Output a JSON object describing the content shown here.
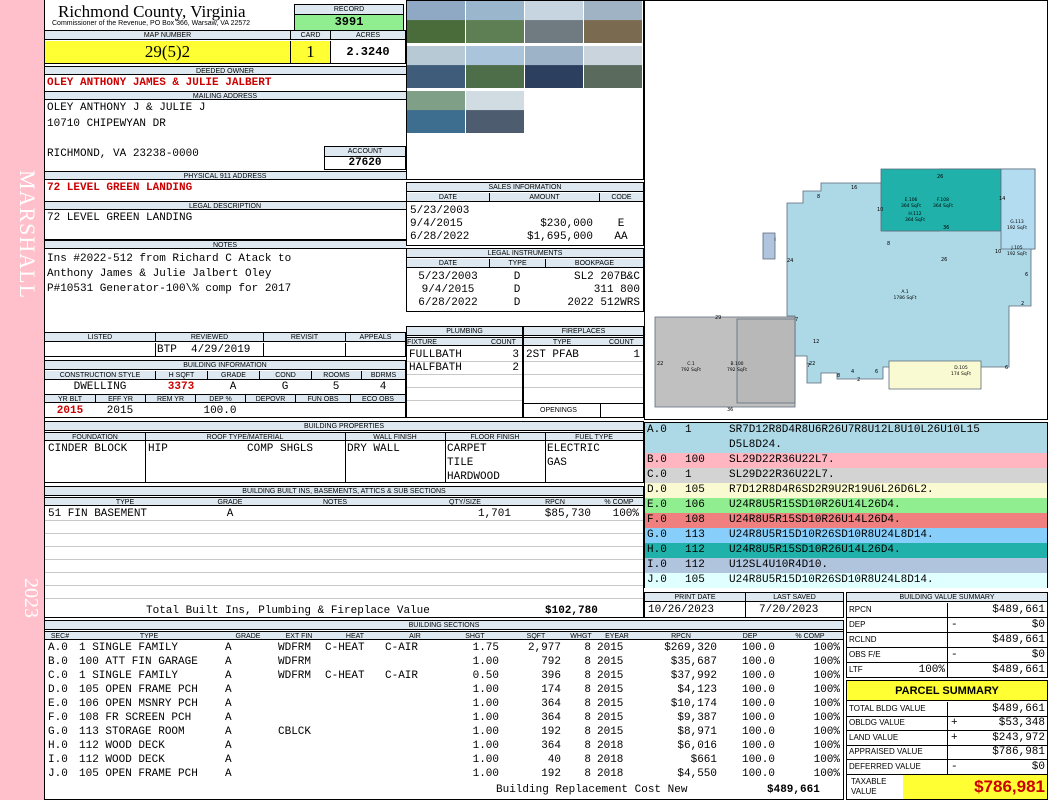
{
  "sidebar": {
    "district": "MARSHALL",
    "year": "2023"
  },
  "header": {
    "county": "Richmond County, Virginia",
    "commissioner": "Commissioner of the Revenue, PO Box 366, Warsaw, VA 22572",
    "record_label": "RECORD",
    "record": "3991",
    "map_label": "MAP NUMBER",
    "map": "29(5)2",
    "card_label": "CARD",
    "card": "1",
    "acres_label": "ACRES",
    "acres": "2.3240"
  },
  "owner": {
    "deeded_label": "DEEDED OWNER",
    "deeded": "OLEY ANTHONY JAMES & JULIE JALBERT",
    "mailing_label": "MAILING ADDRESS",
    "mailing": [
      "OLEY ANTHONY J & JULIE J",
      "10710 CHIPEWYAN DR",
      "",
      "RICHMOND, VA 23238-0000"
    ],
    "account_label": "ACCOUNT",
    "account": "27620",
    "physical_label": "PHYSICAL 911 ADDRESS",
    "physical": "72 LEVEL GREEN LANDING",
    "legal_label": "LEGAL DESCRIPTION",
    "legal": "72 LEVEL GREEN LANDING",
    "notes_label": "NOTES",
    "notes": [
      "Ins #2022-512 from Richard C Atack to",
      "Anthony James & Julie Jalbert Oley",
      "P#10531 Generator-100\\% comp for 2017"
    ]
  },
  "sales": {
    "title": "SALES INFORMATION",
    "headers": [
      "DATE",
      "AMOUNT",
      "CODE"
    ],
    "rows": [
      [
        "5/23/2003",
        "",
        ""
      ],
      [
        "9/4/2015",
        "$230,000",
        "E"
      ],
      [
        "6/28/2022",
        "$1,695,000",
        "AA"
      ]
    ]
  },
  "instruments": {
    "title": "LEGAL INSTRUMENTS",
    "headers": [
      "DATE",
      "TYPE",
      "BOOKPAGE"
    ],
    "rows": [
      [
        "5/23/2003",
        "D",
        "SL2 207B&C"
      ],
      [
        "9/4/2015",
        "D",
        "311 800"
      ],
      [
        "6/28/2022",
        "D",
        "2022 512WRS"
      ]
    ]
  },
  "review": {
    "headers": [
      "LISTED",
      "REVIEWED",
      "REVISIT",
      "APPEALS"
    ],
    "reviewed_by": "BTP",
    "reviewed_date": "4/29/2019"
  },
  "building_info": {
    "title": "BUILDING INFORMATION",
    "headers": [
      "CONSTRUCTION STYLE",
      "H SQFT",
      "GRADE",
      "COND",
      "ROOMS",
      "BDRMS"
    ],
    "values": [
      "DWELLING",
      "3373",
      "A",
      "G",
      "5",
      "4"
    ],
    "headers2": [
      "YR BLT",
      "EFF YR",
      "REM YR",
      "DEP %",
      "DEPOVR",
      "FUN OBS",
      "ECO OBS"
    ],
    "values2": [
      "2015",
      "2015",
      "",
      "100.0",
      "",
      "",
      ""
    ]
  },
  "plumbing": {
    "title": "PLUMBING",
    "headers": [
      "FIXTURE",
      "COUNT"
    ],
    "rows": [
      [
        "FULLBATH",
        "3"
      ],
      [
        "HALFBATH",
        "2"
      ]
    ]
  },
  "fireplaces": {
    "title": "FIREPLACES",
    "headers": [
      "TYPE",
      "COUNT"
    ],
    "rows": [
      [
        "2ST PFAB",
        "1"
      ]
    ],
    "openings": "OPENINGS"
  },
  "properties": {
    "title": "BUILDING PROPERTIES",
    "headers": [
      "FOUNDATION",
      "ROOF TYPE/MATERIAL",
      "WALL FINISH",
      "FLOOR FINISH",
      "FUEL TYPE"
    ],
    "foundation": "CINDER BLOCK",
    "roof_type": "HIP",
    "roof_material": "COMP SHGLS",
    "wall": "DRY WALL",
    "floor": [
      "CARPET",
      "TILE",
      "HARDWOOD"
    ],
    "fuel": [
      "ELECTRIC",
      "GAS"
    ]
  },
  "built_ins": {
    "title": "BUILDING BUILT INS, BASEMENTS, ATTICS & SUB SECTIONS",
    "headers": [
      "TYPE",
      "GRADE",
      "NOTES",
      "QTY/SIZE",
      "RPCN",
      "% COMP"
    ],
    "rows": [
      [
        "51 FIN BASEMENT",
        "A",
        "",
        "1,701",
        "$85,730",
        "100%"
      ]
    ],
    "total_label": "Total Built Ins, Plumbing & Fireplace Value",
    "total": "$102,780"
  },
  "print_info": {
    "print_label": "PRINT DATE",
    "print": "10/26/2023",
    "saved_label": "LAST SAVED",
    "saved": "7/20/2023"
  },
  "sketch_codes": [
    {
      "sec": "A.0",
      "code": "1",
      "desc": "SR7D12R8D4R8U6R26U7R8U12L8U10L26U10L15",
      "desc2": "D5L8D24.",
      "color": "#add8e6"
    },
    {
      "sec": "B.0",
      "code": "100",
      "desc": "SL29D22R36U22L7.",
      "color": "#ffb6c1"
    },
    {
      "sec": "C.0",
      "code": "1",
      "desc": "SL29D22R36U22L7.",
      "color": "#d3d3d3"
    },
    {
      "sec": "D.0",
      "code": "105",
      "desc": "R7D12R8D4R6SD2R9U2R19U6L26D6L2.",
      "color": "#fafad2"
    },
    {
      "sec": "E.0",
      "code": "106",
      "desc": "U24R8U5R15SD10R26U14L26D4.",
      "color": "#90ee90"
    },
    {
      "sec": "F.0",
      "code": "108",
      "desc": "U24R8U5R15SD10R26U14L26D4.",
      "color": "#f08080"
    },
    {
      "sec": "G.0",
      "code": "113",
      "desc": "U24R8U5R15D10R26SD10R8U24L8D14.",
      "color": "#87cefa"
    },
    {
      "sec": "H.0",
      "code": "112",
      "desc": "U24R8U5R15SD10R26U14L26D4.",
      "color": "#20b2aa"
    },
    {
      "sec": "I.0",
      "code": "112",
      "desc": "U12SL4U10R4D10.",
      "color": "#b0c4de"
    },
    {
      "sec": "J.0",
      "code": "105",
      "desc": "U24R8U5R15D10R26SD10R8U24L8D14.",
      "color": "#e0ffff"
    }
  ],
  "sketch": {
    "labels": [
      {
        "t": "A.1"
      },
      {
        "t": "1786 SqFt"
      },
      {
        "t": "C.1"
      },
      {
        "t": "792 SqFt"
      },
      {
        "t": "B.100"
      },
      {
        "t": "792 SqFt"
      },
      {
        "t": "D.105"
      },
      {
        "t": "174 SqFt"
      },
      {
        "t": "E.106"
      },
      {
        "t": "364 SqFt"
      },
      {
        "t": "F.108"
      },
      {
        "t": "364 SqFt"
      },
      {
        "t": "H.112"
      },
      {
        "t": "364 SqFt"
      },
      {
        "t": "G.113"
      },
      {
        "t": "192 SqFt"
      },
      {
        "t": "J.105"
      },
      {
        "t": "192 SqFt"
      },
      {
        "t": "I"
      }
    ],
    "dims": [
      "26",
      "14",
      "16",
      "10",
      "8",
      "8",
      "36",
      "24",
      "26",
      "10",
      "6",
      "2",
      "12",
      "7",
      "7",
      "2",
      "29",
      "22",
      "22",
      "8",
      "4",
      "6",
      "6",
      "36"
    ]
  },
  "sections": {
    "title": "BUILDING SECTIONS",
    "headers": [
      "SEC#",
      "TYPE",
      "GRADE",
      "EXT FIN",
      "HEAT",
      "AIR",
      "SHGT",
      "SQFT",
      "WHGT",
      "EYEAR",
      "RPCN",
      "DEP",
      "% COMP"
    ],
    "rows": [
      [
        "A.0",
        "1 SINGLE FAMILY",
        "A",
        "WDFRM",
        "C-HEAT",
        "C-AIR",
        "1.75",
        "2,977",
        "8",
        "2015",
        "$269,320",
        "100.0",
        "100%"
      ],
      [
        "B.0",
        "100 ATT FIN GARAGE",
        "A",
        "WDFRM",
        "",
        "",
        "1.00",
        "792",
        "8",
        "2015",
        "$35,687",
        "100.0",
        "100%"
      ],
      [
        "C.0",
        "1 SINGLE FAMILY",
        "A",
        "WDFRM",
        "C-HEAT",
        "C-AIR",
        "0.50",
        "396",
        "8",
        "2015",
        "$37,992",
        "100.0",
        "100%"
      ],
      [
        "D.0",
        "105 OPEN FRAME PCH",
        "A",
        "",
        "",
        "",
        "1.00",
        "174",
        "8",
        "2015",
        "$4,123",
        "100.0",
        "100%"
      ],
      [
        "E.0",
        "106 OPEN MSNRY PCH",
        "A",
        "",
        "",
        "",
        "1.00",
        "364",
        "8",
        "2015",
        "$10,174",
        "100.0",
        "100%"
      ],
      [
        "F.0",
        "108 FR SCREEN PCH",
        "A",
        "",
        "",
        "",
        "1.00",
        "364",
        "8",
        "2015",
        "$9,387",
        "100.0",
        "100%"
      ],
      [
        "G.0",
        "113 STORAGE ROOM",
        "A",
        "CBLCK",
        "",
        "",
        "1.00",
        "192",
        "8",
        "2015",
        "$8,971",
        "100.0",
        "100%"
      ],
      [
        "H.0",
        "112 WOOD DECK",
        "A",
        "",
        "",
        "",
        "1.00",
        "364",
        "8",
        "2018",
        "$6,016",
        "100.0",
        "100%"
      ],
      [
        "I.0",
        "112 WOOD DECK",
        "A",
        "",
        "",
        "",
        "1.00",
        "40",
        "8",
        "2018",
        "$661",
        "100.0",
        "100%"
      ],
      [
        "J.0",
        "105 OPEN FRAME PCH",
        "A",
        "",
        "",
        "",
        "1.00",
        "192",
        "8",
        "2018",
        "$4,550",
        "100.0",
        "100%"
      ]
    ],
    "replacement_label": "Building Replacement Cost New",
    "replacement": "$489,661"
  },
  "value_summary": {
    "title": "BUILDING VALUE SUMMARY",
    "rows": [
      {
        "label": "RPCN",
        "sign": "",
        "pct": "",
        "value": "$489,661"
      },
      {
        "label": "DEP",
        "sign": "-",
        "pct": "",
        "value": "$0"
      },
      {
        "label": "RCLND",
        "sign": "",
        "pct": "",
        "value": "$489,661"
      },
      {
        "label": "OBS F/E",
        "sign": "-",
        "pct": "",
        "value": "$0"
      },
      {
        "label": "LTF",
        "sign": "",
        "pct": "100%",
        "value": "$489,661"
      }
    ]
  },
  "parcel": {
    "title": "PARCEL SUMMARY",
    "rows": [
      {
        "label": "TOTAL BLDG VALUE",
        "sign": "",
        "value": "$489,661"
      },
      {
        "label": "OBLDG VALUE",
        "sign": "+",
        "value": "$53,348"
      },
      {
        "label": "LAND VALUE",
        "sign": "+",
        "value": "$243,972"
      },
      {
        "label": "APPRAISED VALUE",
        "sign": "",
        "value": "$786,981"
      },
      {
        "label": "DEFERRED VALUE",
        "sign": "-",
        "value": "$0"
      }
    ],
    "taxable_label": "TAXABLE VALUE",
    "taxable": "$786,981"
  },
  "colors": {
    "sidebar": "#ffc0cb",
    "header_fill": "#dde8f0",
    "highlight_yellow": "#ffff33",
    "record_green": "#90ee90"
  },
  "photos": [
    "waterfront-photo",
    "pier-photo",
    "dock-photo",
    "boardwalk-photo",
    "boat-lift-photo",
    "house-rear-photo",
    "solar-panel-photo",
    "shoreline-photo",
    "pool-photo",
    "house-front-photo"
  ]
}
